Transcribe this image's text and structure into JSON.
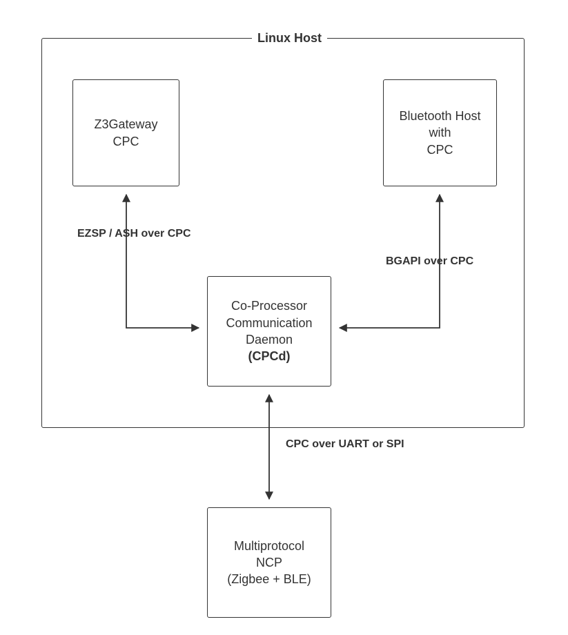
{
  "diagram": {
    "title": "Linux Host",
    "nodes": {
      "z3gateway": {
        "line1": "Z3Gateway",
        "line2": "CPC"
      },
      "bthost": {
        "line1": "Bluetooth Host",
        "line2": "with",
        "line3": "CPC"
      },
      "cpcd": {
        "line1": "Co-Processor",
        "line2": "Communication",
        "line3": "Daemon",
        "line4": "(CPCd)"
      },
      "ncp": {
        "line1": "Multiprotocol",
        "line2": "NCP",
        "line3": "(Zigbee + BLE)"
      }
    },
    "edges": {
      "ezsp": "EZSP / ASH over CPC",
      "bgapi": "BGAPI over CPC",
      "uart": "CPC over UART or SPI"
    }
  }
}
